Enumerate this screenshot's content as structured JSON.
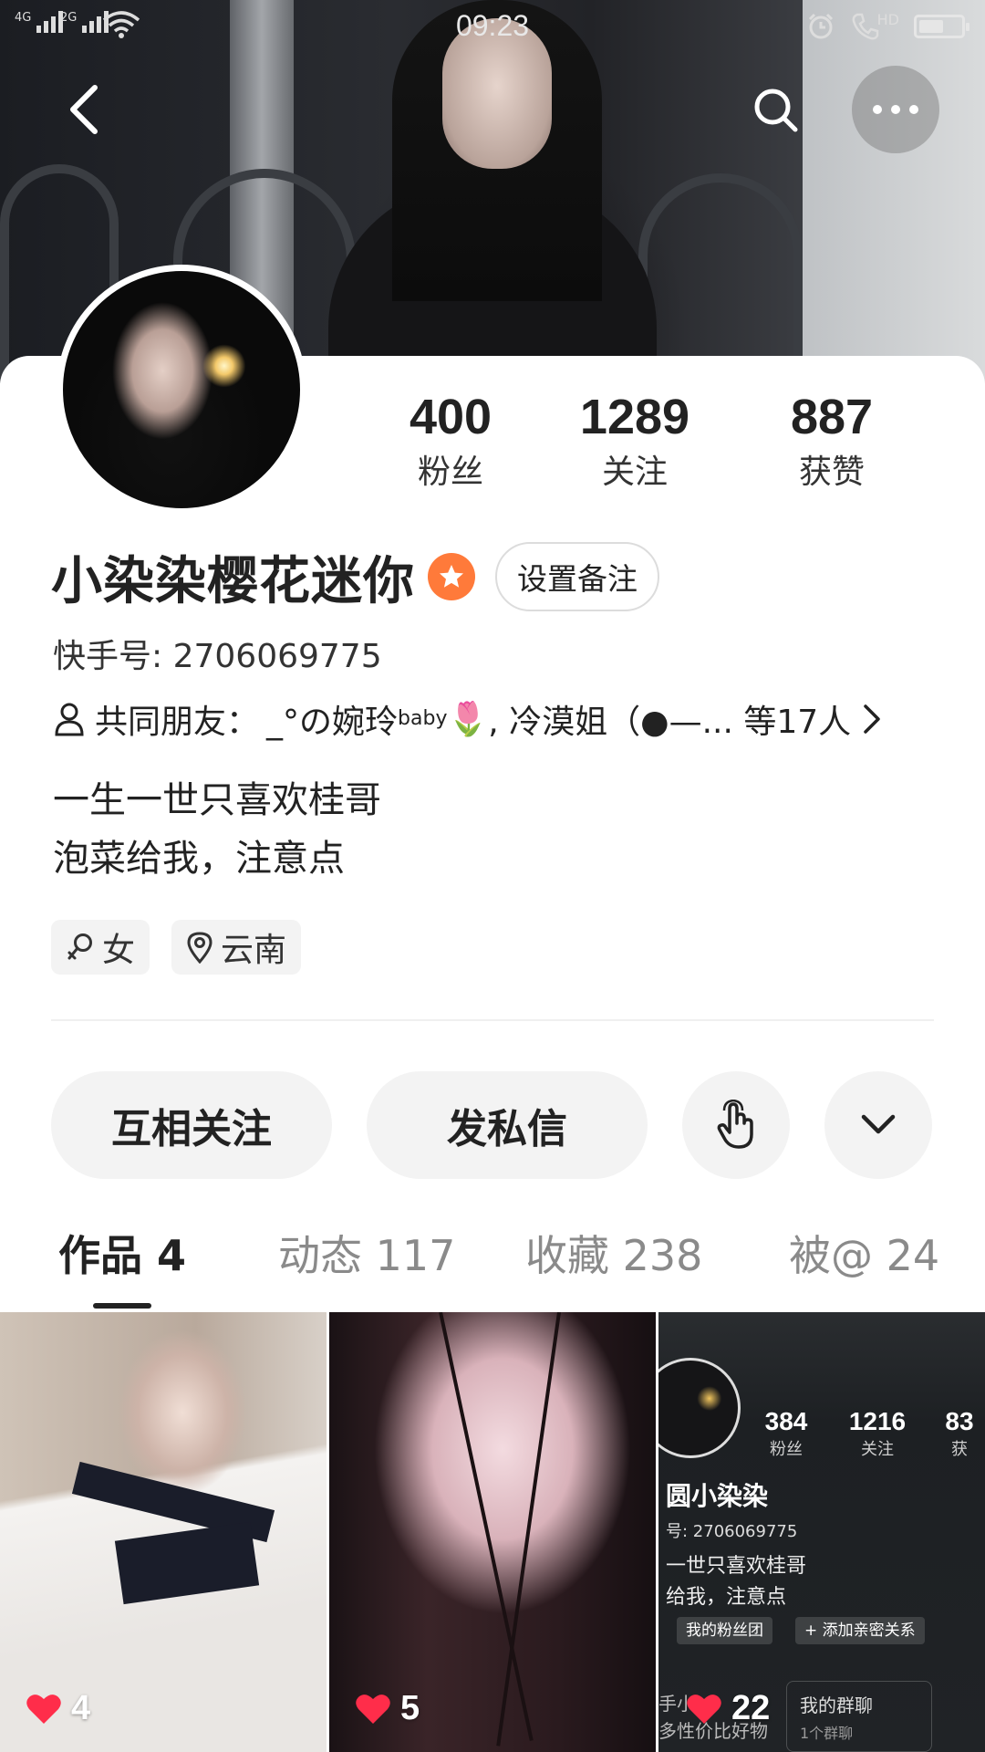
{
  "status_bar": {
    "time": "09:23",
    "signal1_label": "4G",
    "signal2_label": "2G",
    "call_label": "HD",
    "battery_level": 0.6
  },
  "header": {
    "back_icon": "chevron-left-icon",
    "search_icon": "search-icon",
    "more_icon": "more-horizontal-icon"
  },
  "profile": {
    "stats": [
      {
        "value": "400",
        "label": "粉丝"
      },
      {
        "value": "1289",
        "label": "关注"
      },
      {
        "value": "887",
        "label": "获赞"
      }
    ],
    "username": "小染染樱花迷你",
    "badge_icon": "star-badge-icon",
    "badge_color": "#ff7a3a",
    "remark_label": "设置备注",
    "kuaishou_id": "快手号: 2706069775",
    "mutual_prefix": "共同朋友：",
    "mutual_friend1": "_°の婉玲",
    "mutual_friend1_sup": "baby",
    "mutual_friend1_emoji": "🌷",
    "mutual_rest": ", 冷漠姐（●—... 等17人",
    "bio_lines": [
      "一生一世只喜欢桂哥",
      "泡菜给我，注意点"
    ],
    "tags": [
      {
        "icon": "female-icon",
        "label": "女"
      },
      {
        "icon": "location-pin-icon",
        "label": "云南"
      }
    ]
  },
  "actions": {
    "follow_label": "互相关注",
    "message_label": "发私信",
    "poke_icon": "tap-hand-icon",
    "expand_icon": "chevron-down-icon"
  },
  "tabs": [
    {
      "label": "作品 4",
      "active": true
    },
    {
      "label": "动态 117",
      "active": false
    },
    {
      "label": "收藏 238",
      "active": false
    },
    {
      "label": "被@ 24",
      "active": false
    }
  ],
  "works": [
    {
      "likes": "4"
    },
    {
      "likes": "5"
    },
    {
      "likes": "22"
    }
  ],
  "work3_preview": {
    "stats": [
      {
        "value": "384",
        "label": "粉丝"
      },
      {
        "value": "1216",
        "label": "关注"
      },
      {
        "value": "83",
        "label": "获"
      }
    ],
    "name": "圆小染染",
    "id": "号: 2706069775",
    "bio": [
      "一世只喜欢桂哥",
      "给我，注意点"
    ],
    "pill1": "我的粉丝团",
    "pill2": "+ 添加亲密关系",
    "group_title": "我的群聊",
    "group_sub": "1个群聊",
    "left_text": "手小",
    "left_sub": "多性价比好物"
  },
  "colors": {
    "like_heart": "#ff2d4a",
    "accent_badge": "#ff7a3a"
  }
}
